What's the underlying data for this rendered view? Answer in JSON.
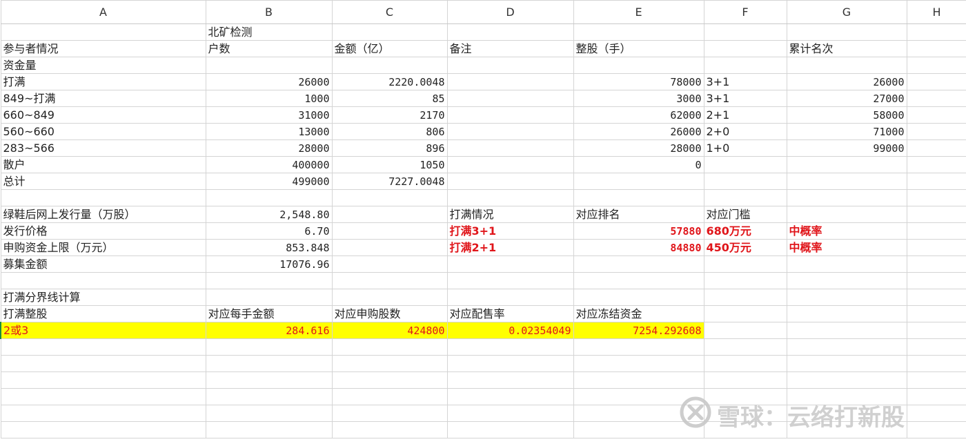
{
  "columns": [
    "A",
    "B",
    "C",
    "D",
    "E",
    "F",
    "G",
    "H"
  ],
  "rows": [
    [
      "",
      "北矿检测",
      "",
      "",
      "",
      "",
      "",
      ""
    ],
    [
      "参与者情况",
      "户数",
      "金额（亿）",
      "备注",
      "整股（手）",
      "",
      "累计名次",
      ""
    ],
    [
      "资金量",
      "",
      "",
      "",
      "",
      "",
      "",
      ""
    ],
    [
      "打满",
      "26000",
      "2220.0048",
      "",
      "78000",
      "3+1",
      "26000",
      ""
    ],
    [
      "849~打满",
      "1000",
      "85",
      "",
      "3000",
      "3+1",
      "27000",
      ""
    ],
    [
      "660~849",
      "31000",
      "2170",
      "",
      "62000",
      "2+1",
      "58000",
      ""
    ],
    [
      "560~660",
      "13000",
      "806",
      "",
      "26000",
      "2+0",
      "71000",
      ""
    ],
    [
      "283~566",
      "28000",
      "896",
      "",
      "28000",
      "1+0",
      "99000",
      ""
    ],
    [
      "散户",
      "400000",
      "1050",
      "",
      "0",
      "",
      "",
      ""
    ],
    [
      "总计",
      "499000",
      "7227.0048",
      "",
      "",
      "",
      "",
      ""
    ],
    [
      "",
      "",
      "",
      "",
      "",
      "",
      "",
      ""
    ],
    [
      "绿鞋后网上发行量（万股）",
      "2,548.80",
      "",
      "打满情况",
      "对应排名",
      "对应门槛",
      "",
      ""
    ],
    [
      "发行价格",
      "6.70",
      "",
      "打满3+1",
      "57880",
      "680万元",
      "中概率",
      ""
    ],
    [
      "申购资金上限（万元）",
      "853.848",
      "",
      "打满2+1",
      "84880",
      "450万元",
      "中概率",
      ""
    ],
    [
      "募集金额",
      "17076.96",
      "",
      "",
      "",
      "",
      "",
      ""
    ],
    [
      "",
      "",
      "",
      "",
      "",
      "",
      "",
      ""
    ],
    [
      "打满分界线计算",
      "",
      "",
      "",
      "",
      "",
      "",
      ""
    ],
    [
      "打满整股",
      "对应每手金额",
      "对应申购股数",
      "对应配售率",
      "对应冻结资金",
      "",
      "",
      ""
    ],
    [
      "2或3",
      "284.616",
      "424800",
      "0.02354049",
      "7254.292608",
      "",
      "",
      ""
    ],
    [
      "",
      "",
      "",
      "",
      "",
      "",
      "",
      ""
    ],
    [
      "",
      "",
      "",
      "",
      "",
      "",
      "",
      ""
    ],
    [
      "",
      "",
      "",
      "",
      "",
      "",
      "",
      ""
    ],
    [
      "",
      "",
      "",
      "",
      "",
      "",
      "",
      ""
    ],
    [
      "",
      "",
      "",
      "",
      "",
      "",
      "",
      ""
    ],
    [
      "",
      "",
      "",
      "",
      "",
      "",
      "",
      ""
    ]
  ],
  "watermark": "雪球：云络打新股",
  "watermark_icon": "snowball-logo-icon"
}
